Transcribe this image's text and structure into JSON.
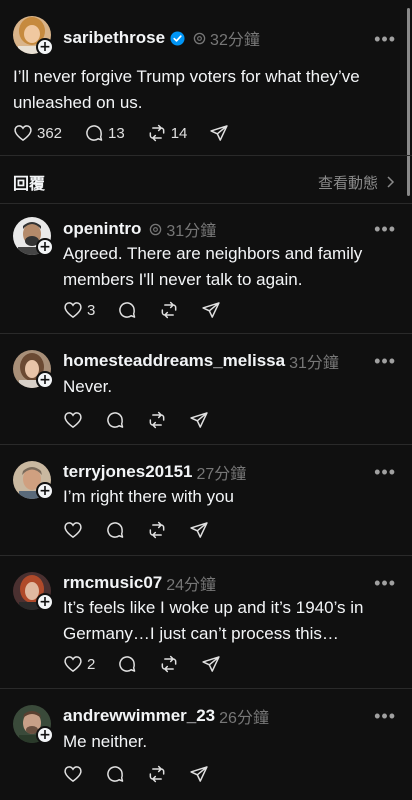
{
  "main_post": {
    "username": "saribethrose",
    "time": "32分鐘",
    "text": "I’ll never forgive Trump voters for what they’ve unleashed on us.",
    "likes": "362",
    "comments": "13",
    "reposts": "14"
  },
  "reply_bar": {
    "label": "回覆",
    "view_activity": "查看動態"
  },
  "replies": [
    {
      "username": "openintro",
      "time": "31分鐘",
      "text": "Agreed. There are neighbors and family members I'll never talk to again.",
      "likes": "3"
    },
    {
      "username": "homesteaddreams_melissa",
      "time": "31分鐘",
      "text": "Never.",
      "likes": ""
    },
    {
      "username": "terryjones20151",
      "time": "27分鐘",
      "text": "I’m right there with you",
      "likes": ""
    },
    {
      "username": "rmcmusic07",
      "time": "24分鐘",
      "text": "It’s feels like I woke up and it’s 1940’s in Germany…I just can’t process this…",
      "likes": "2"
    },
    {
      "username": "andrewwimmer_23",
      "time": "26分鐘",
      "text": "Me neither.",
      "likes": ""
    }
  ],
  "colors": {
    "background": "#101010",
    "primary_text": "#f3f5f7",
    "secondary_text": "#777777",
    "verified": "#0095f6"
  }
}
